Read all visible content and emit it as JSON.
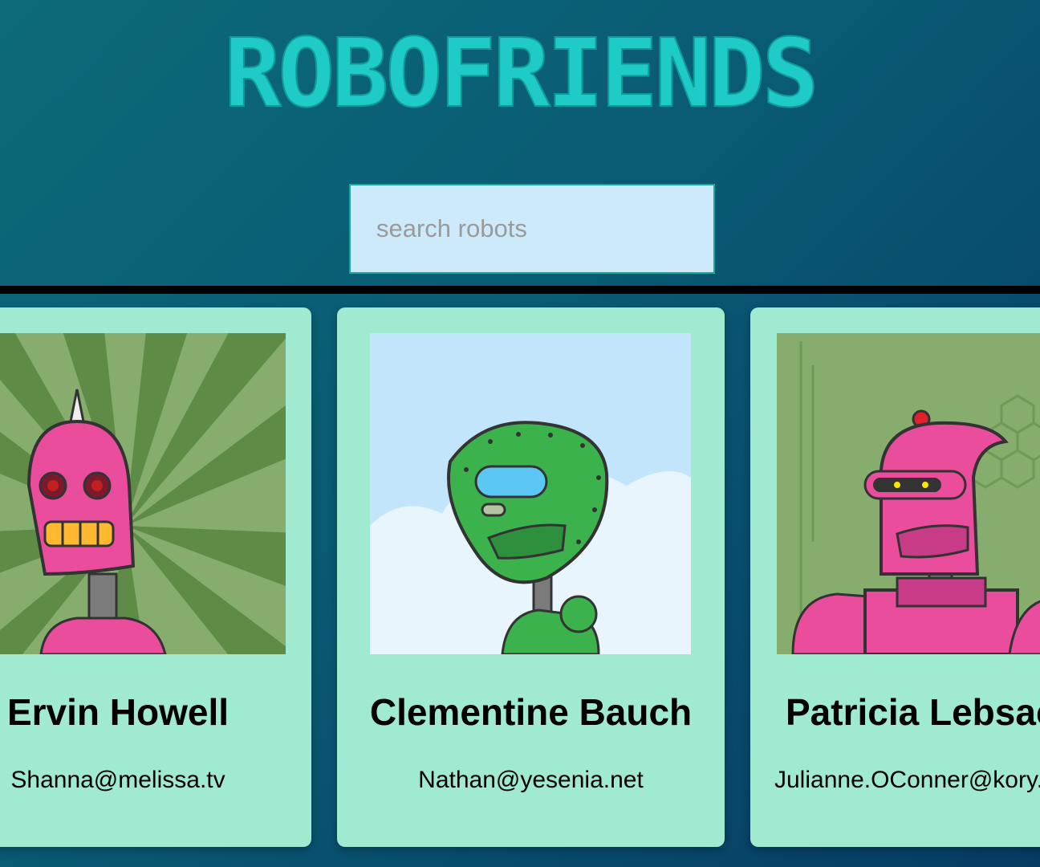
{
  "header": {
    "title": "RoboFriends"
  },
  "search": {
    "placeholder": "search robots",
    "value": ""
  },
  "robots": [
    {
      "name": "Ervin Howell",
      "email": "Shanna@melissa.tv"
    },
    {
      "name": "Clementine Bauch",
      "email": "Nathan@yesenia.net"
    },
    {
      "name": "Patricia Lebsack",
      "email": "Julianne.OConner@kory.org"
    }
  ],
  "colors": {
    "title": "#1ecbc6",
    "card_background": "#9fead1",
    "search_background": "#cdeafb",
    "page_gradient_start": "#0c6a7a",
    "page_gradient_end": "#073b63"
  }
}
